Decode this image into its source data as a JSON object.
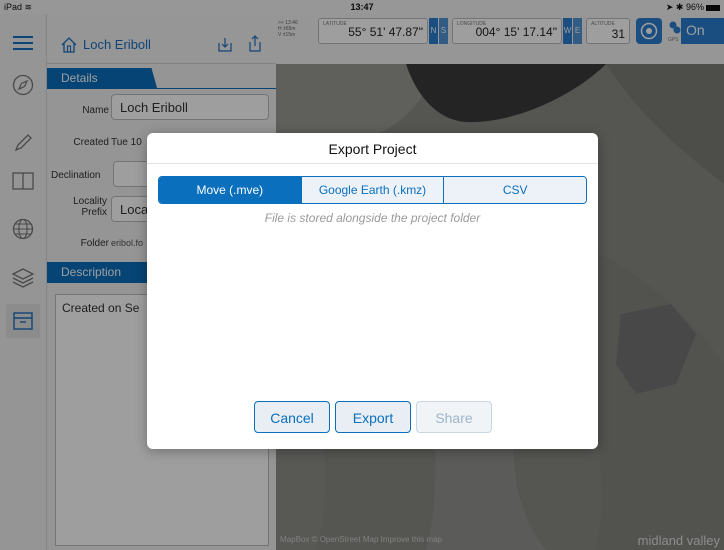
{
  "status_bar": {
    "device": "iPad",
    "time": "13:47",
    "battery": "96%"
  },
  "sidebar_rail": {
    "items": [
      {
        "name": "menu",
        "icon": "hamburger-icon"
      },
      {
        "name": "compass",
        "icon": "compass-icon"
      },
      {
        "name": "pencil",
        "icon": "pencil-icon"
      },
      {
        "name": "book",
        "icon": "book-icon"
      },
      {
        "name": "globe",
        "icon": "globe-icon"
      },
      {
        "name": "layers",
        "icon": "layers-icon"
      },
      {
        "name": "archive",
        "icon": "archive-icon"
      }
    ]
  },
  "project": {
    "title": "Loch Eriboll",
    "details_tab": "Details",
    "name_label": "Name",
    "name_value": "Loch Eriboll",
    "created_label": "Created",
    "created_value": "Tue 10",
    "declination_label": "Declination",
    "locality_label": "Locality Prefix",
    "locality_value": "Loca",
    "folder_label": "Folder",
    "folder_value": "eribol.fo",
    "description_tab": "Description",
    "description_text": "Created on Se"
  },
  "gps": {
    "time": "13:46",
    "h_accuracy": "H ±65m",
    "v_accuracy": "V ±15m",
    "latitude_label": "LATITUDE",
    "latitude": "55° 51' 47.87\"",
    "lat_n": "N",
    "lat_s": "S",
    "longitude_label": "LONGITUDE",
    "longitude": "004° 15' 17.14\"",
    "lon_w": "W",
    "lon_e": "E",
    "altitude_label": "ALTITUDE",
    "altitude": "31",
    "toggle": "On",
    "gps_caption": "GPS"
  },
  "map": {
    "credit": "MapBox © OpenStreet Map   Improve this map",
    "brand": "midland valley"
  },
  "modal": {
    "title": "Export Project",
    "segments": [
      "Move (.mve)",
      "Google Earth (.kmz)",
      "CSV"
    ],
    "selected_segment": "Move (.mve)",
    "hint": "File is stored alongside the project folder",
    "cancel_label": "Cancel",
    "export_label": "Export",
    "share_label": "Share"
  },
  "colors": {
    "accent": "#0a6fbd",
    "disabled": "#9cb4cc"
  }
}
